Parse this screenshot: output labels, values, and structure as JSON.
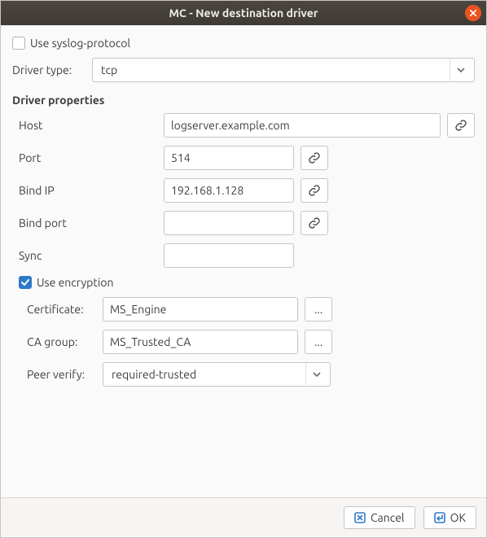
{
  "window": {
    "title": "MC - New destination driver"
  },
  "syslog": {
    "checked": false,
    "label": "Use syslog-protocol"
  },
  "driver_type": {
    "label": "Driver type:",
    "value": "tcp"
  },
  "section": {
    "title": "Driver properties"
  },
  "props": {
    "host": {
      "label": "Host",
      "value": "logserver.example.com"
    },
    "port": {
      "label": "Port",
      "value": "514"
    },
    "bind_ip": {
      "label": "Bind IP",
      "value": "192.168.1.128"
    },
    "bind_port": {
      "label": "Bind port",
      "value": ""
    },
    "sync": {
      "label": "Sync",
      "value": ""
    }
  },
  "encryption": {
    "checked": true,
    "label": "Use encryption",
    "certificate": {
      "label": "Certificate:",
      "value": "MS_Engine"
    },
    "ca_group": {
      "label": "CA group:",
      "value": "MS_Trusted_CA"
    },
    "peer_verify": {
      "label": "Peer verify:",
      "value": "required-trusted"
    },
    "browse": "..."
  },
  "footer": {
    "cancel": "Cancel",
    "ok": "OK"
  }
}
